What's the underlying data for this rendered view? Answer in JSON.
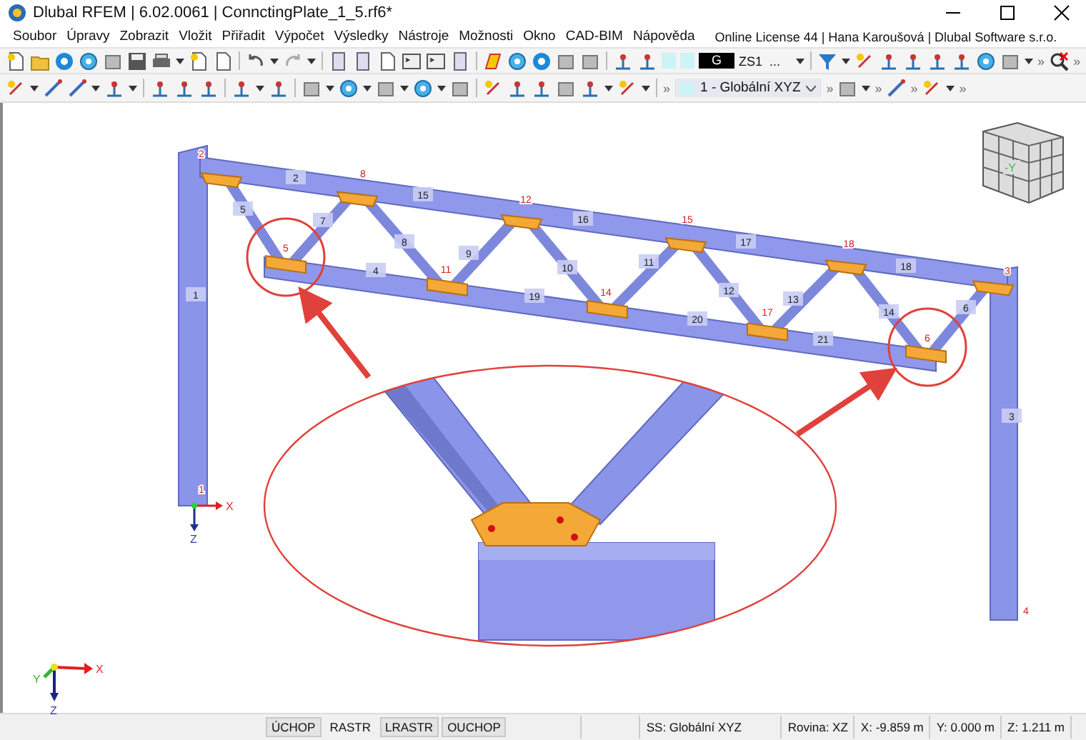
{
  "window": {
    "title": "Dlubal RFEM | 6.02.0061 | ConnctingPlate_1_5.rf6*"
  },
  "menu": {
    "items": [
      "Soubor",
      "Úpravy",
      "Zobrazit",
      "Vložit",
      "Přiřadit",
      "Výpočet",
      "Výsledky",
      "Nástroje",
      "Možnosti",
      "Okno",
      "CAD-BIM",
      "Nápověda"
    ],
    "license": "Online License 44 | Hana Karoušová | Dlubal Software s.r.o."
  },
  "toolbar_1": {
    "load_case_type": "G",
    "load_case": "ZS1",
    "load_case_more": "...",
    "overflow": [
      "»",
      "»"
    ]
  },
  "toolbar_2": {
    "coordinate_system": "1 - Globální XYZ",
    "overflow": [
      "»",
      "»",
      "»",
      "»",
      "»"
    ]
  },
  "viewport": {
    "member_labels": [
      "1",
      "2",
      "3",
      "4",
      "5",
      "6",
      "7",
      "8",
      "9",
      "10",
      "11",
      "12",
      "13",
      "14",
      "15",
      "16",
      "17",
      "18",
      "19",
      "20",
      "21"
    ],
    "node_labels": [
      "1",
      "2",
      "3",
      "4",
      "5",
      "6",
      "8",
      "11",
      "12",
      "14",
      "15",
      "17",
      "18"
    ],
    "view_cube_label": "-Y",
    "global_axes": [
      "X",
      "Y",
      "Z"
    ],
    "local_axes": [
      "X",
      "Z"
    ]
  },
  "status_bar": {
    "toggles": [
      {
        "label": "ÚCHOP",
        "selected": true
      },
      {
        "label": "RASTR",
        "selected": false
      },
      {
        "label": "LRASTR",
        "selected": true
      },
      {
        "label": "OUCHOP",
        "selected": true
      }
    ],
    "panels": [
      "SS: Globální XYZ",
      "Rovina: XZ",
      "X: -9.859 m",
      "Y: 0.000 m",
      "Z: 1.211 m"
    ]
  }
}
